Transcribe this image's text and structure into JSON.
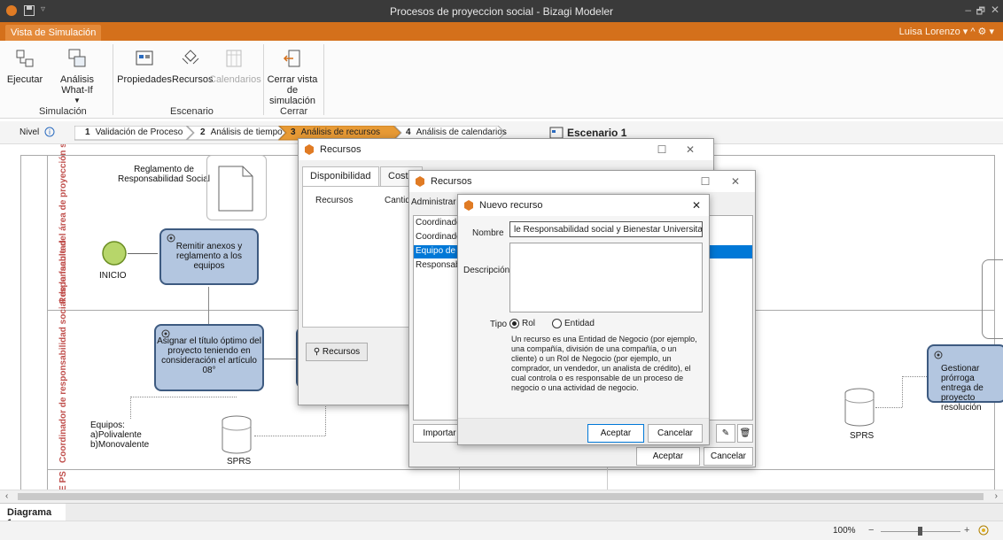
{
  "window": {
    "title": "Procesos de proyeccion social - Bizagi Modeler",
    "controls": {
      "minimize": "–",
      "maximize": "🗗",
      "close": "✕"
    }
  },
  "ribbon": {
    "tab": "Vista de Simulación",
    "user": "Luisa Lorenzo",
    "user_menu": "▾ ^ ⚙ ▾",
    "buttons": {
      "ejecutar": "Ejecutar",
      "whatif": "Análisis What-If",
      "propiedades": "Propiedades",
      "recursos": "Recursos",
      "calendarios": "Calendarios",
      "cerrar_line1": "Cerrar vista",
      "cerrar_line2": "de simulación"
    },
    "groups": {
      "simulacion": "Simulación",
      "escenario": "Escenario",
      "cerrar": "Cerrar"
    }
  },
  "steps": {
    "nivel": "Nivel",
    "items": [
      {
        "n": "1",
        "label": "Validación de Proceso"
      },
      {
        "n": "2",
        "label": "Análisis de tiempo"
      },
      {
        "n": "3",
        "label": "Análisis de recursos"
      },
      {
        "n": "4",
        "label": "Análisis de calendarios"
      }
    ],
    "escenario": "Escenario 1"
  },
  "diagram": {
    "lane1": "Responsable del área de proyección social de EP",
    "lane2": "Coordinador de responsabilidad social de la facultad",
    "lane3": "E PS",
    "reglamento": "Reglamento de Responsabilidad Social",
    "inicio": "INICIO",
    "task1": "Remitir anexos y reglamento a los equipos",
    "task2": "Asignar el título óptimo del proyecto teniendo en consideración el artículo 08°",
    "task3": "Gestionar prórroga entrega de proyecto resolución",
    "equipos": "Equipos:\na)Polivalente\nb)Monovalente",
    "sprs1": "SPRS",
    "sprs2": "SPRS"
  },
  "bottom": {
    "tab": "Diagrama 1",
    "zoom": "100%"
  },
  "dlg1": {
    "title": "Recursos",
    "tabs": [
      "Disponibilidad",
      "Costos"
    ],
    "col1": "Recursos",
    "col2": "Cantidad",
    "btn": "Recursos"
  },
  "dlg2": {
    "title": "Recursos",
    "admin": "Administrar",
    "items": [
      "Coordinador",
      "Coordinador",
      "Equipo de",
      "Responsable"
    ],
    "importar": "Importar",
    "aceptar": "Aceptar",
    "cancelar": "Cancelar"
  },
  "dlg3": {
    "title": "Nuevo recurso",
    "nombre_label": "Nombre",
    "nombre_value": "le Responsabilidad social y Bienestar Universitario",
    "descripcion_label": "Descripción",
    "tipo_label": "Tipo",
    "rol": "Rol",
    "entidad": "Entidad",
    "help": "Un recurso es una Entidad de Negocio (por ejemplo, una compañía, división de una compañía, o un cliente) o un Rol de Negocio (por ejemplo, un comprador, un vendedor, un analista de crédito), el cual controla o es responsable de un proceso de negocio o una actividad de negocio.",
    "aceptar": "Aceptar",
    "cancelar": "Cancelar"
  },
  "colors": {
    "accent": "#d4701b",
    "titlebar": "#3a3a3a",
    "task": "#b3c6e0",
    "lane_text": "#c0504d",
    "selected": "#0078d7"
  }
}
